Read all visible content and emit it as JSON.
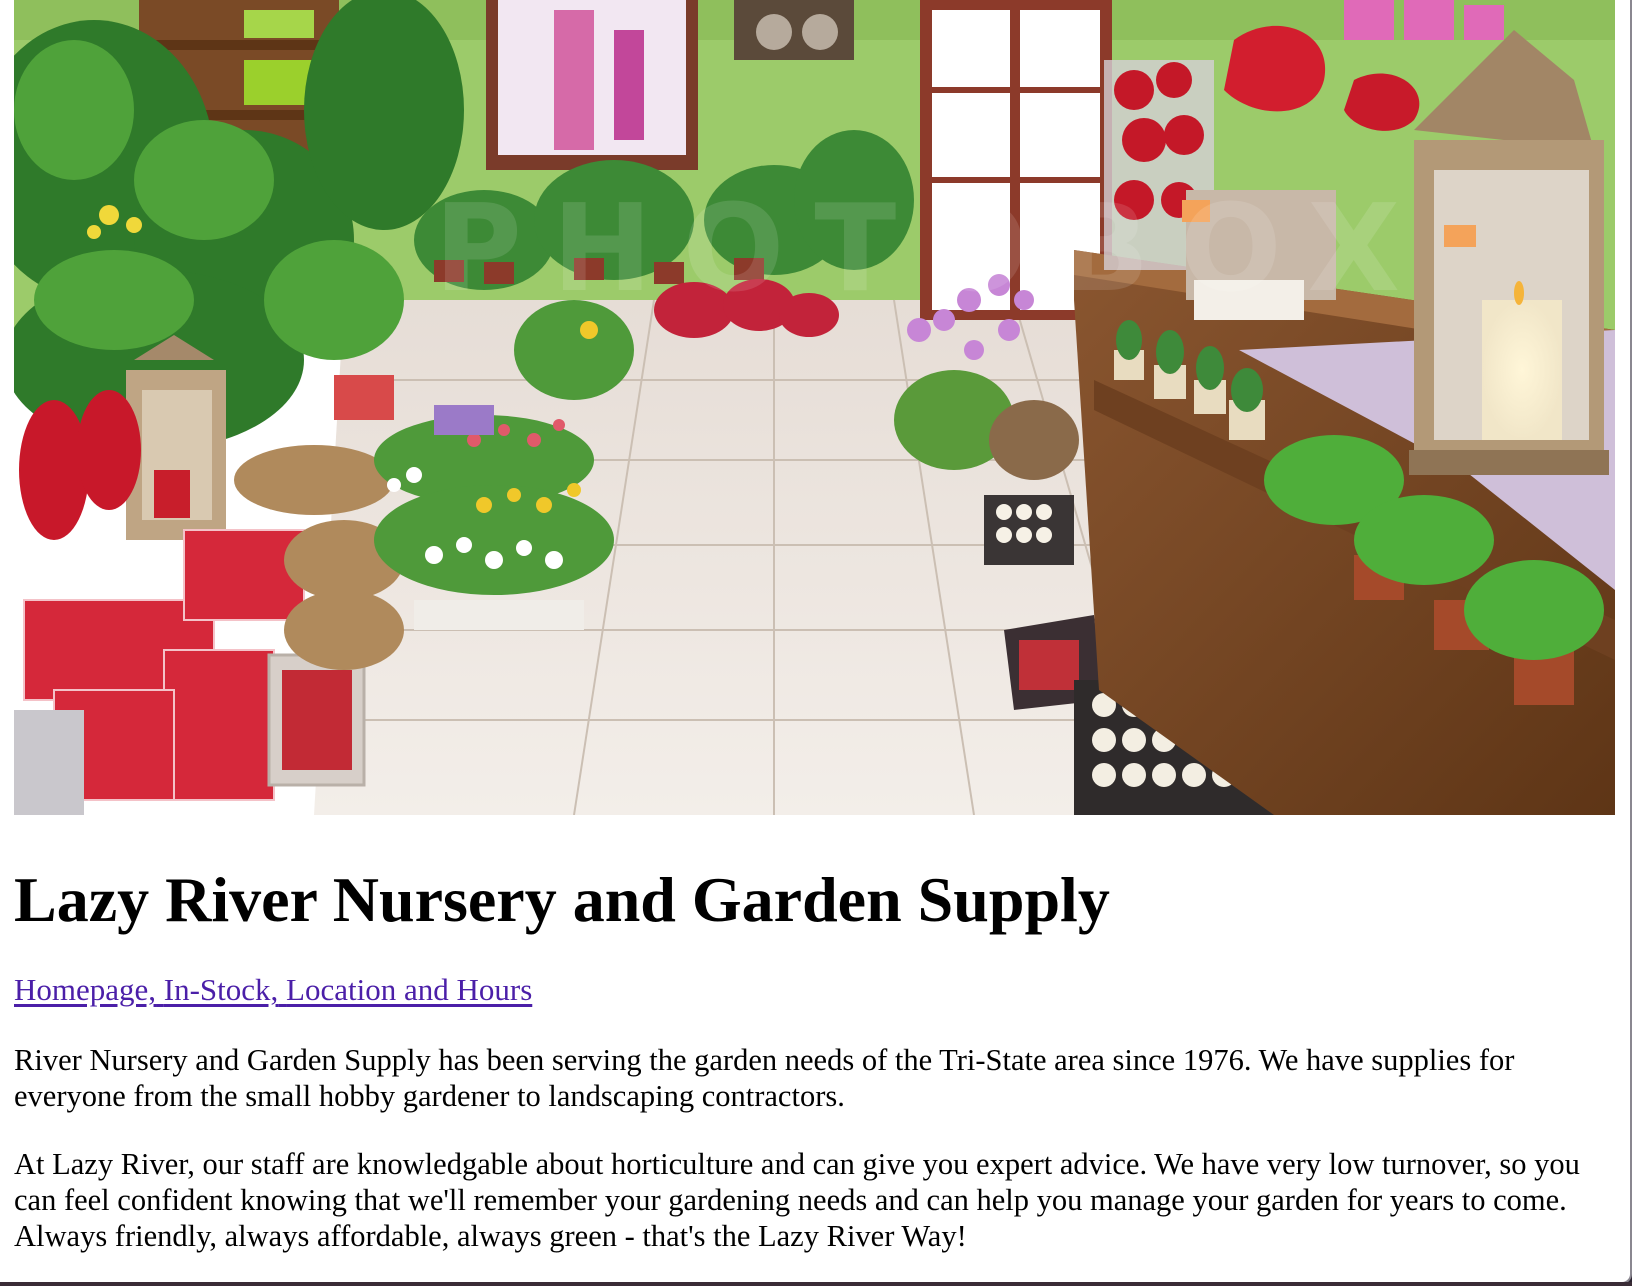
{
  "hero": {
    "alt": "Interior of a flower and garden shop"
  },
  "heading": "Lazy River Nursery and Garden Supply",
  "nav": {
    "links": [
      "Homepage,",
      "In-Stock,",
      "Location and Hours"
    ]
  },
  "paragraphs": [
    "River Nursery and Garden Supply has been serving the garden needs of the Tri-State area since 1976. We have supplies for everyone from the small hobby gardener to landscaping contractors.",
    "At Lazy River, our staff are knowledgable about horticulture and can give you expert advice. We have very low turnover, so you can feel confident knowing that we'll remember your gardening needs and can help you manage your garden for years to come. Always friendly, always affordable, always green - that's the Lazy River Way!"
  ],
  "colors": {
    "link": "#4b1fa8",
    "wall": "#9ccb6a",
    "floor": "#ece4dc",
    "wood": "#7a4a26"
  }
}
